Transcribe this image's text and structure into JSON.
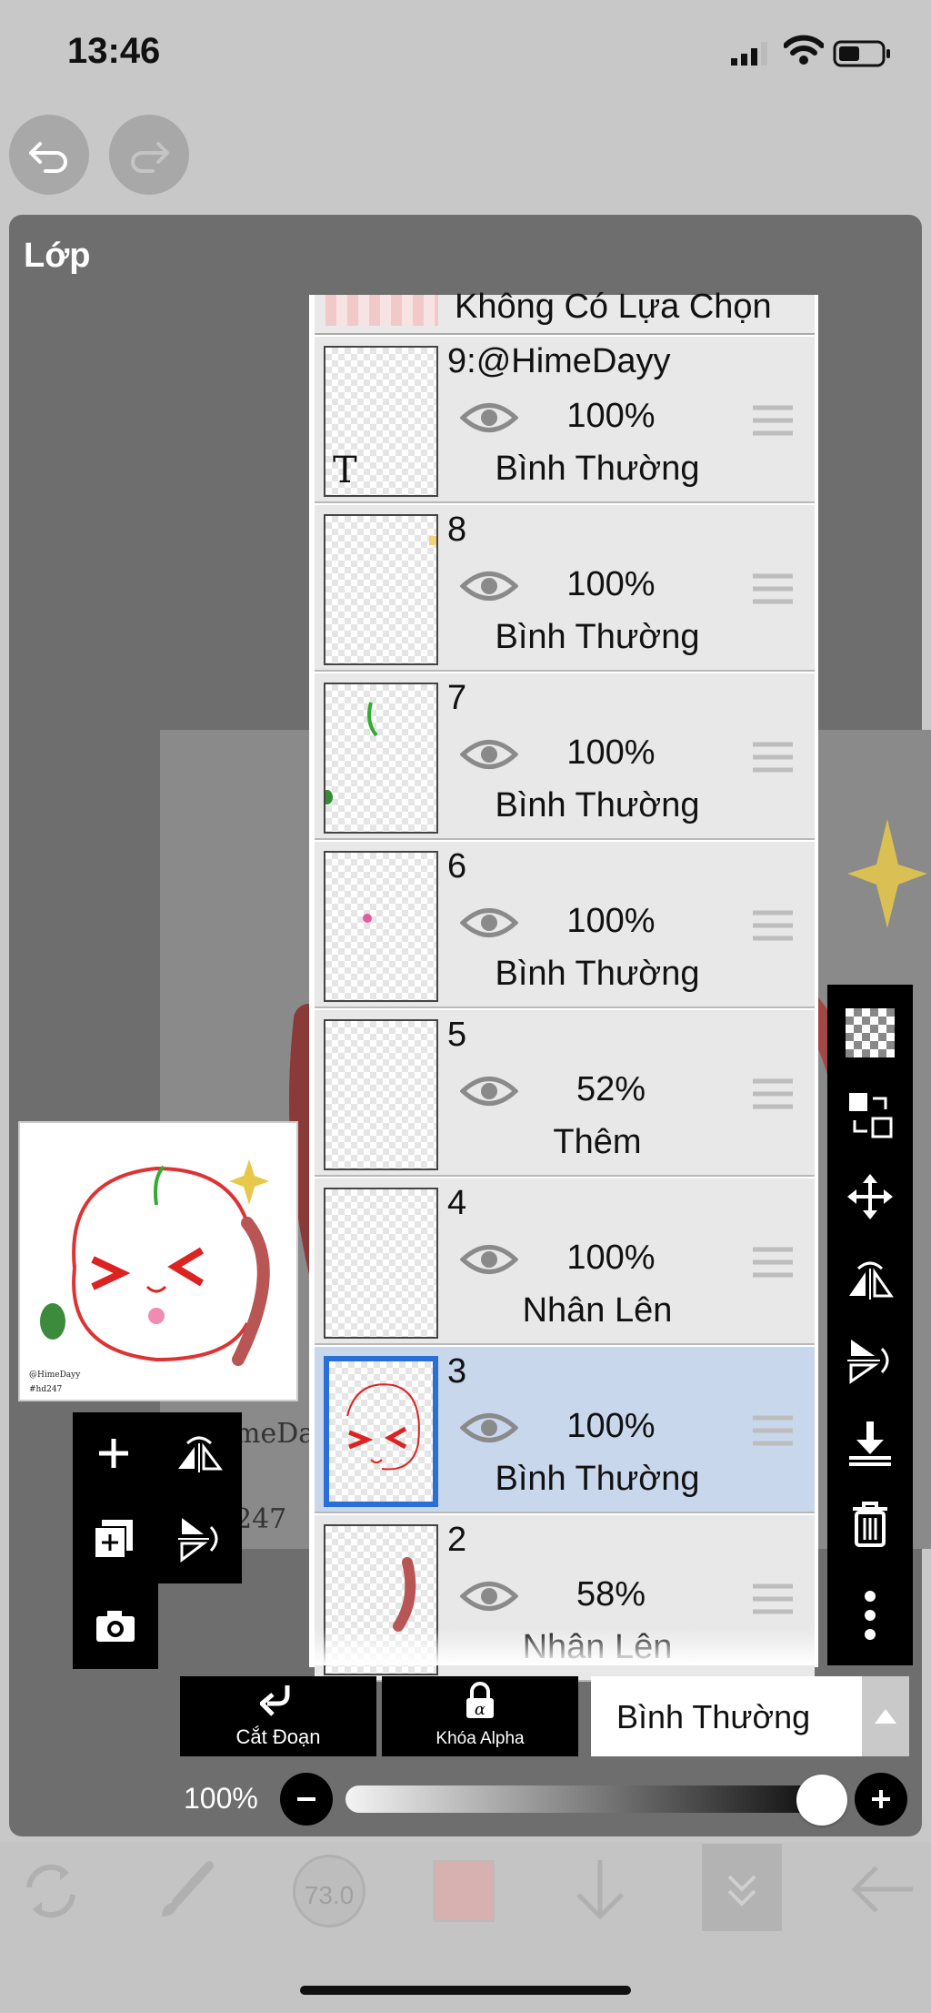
{
  "status_bar": {
    "time": "13:46"
  },
  "toolbar": {
    "undo_icon": "undo-icon",
    "redo_icon": "redo-icon"
  },
  "panel": {
    "title": "Lớp"
  },
  "canvas": {
    "text1": "meDa",
    "text2": "247"
  },
  "preview": {
    "text1": "@HimeDayy",
    "text2": "#hd247"
  },
  "layer_list": {
    "top_label": "Không Có Lựa Chọn",
    "layers": [
      {
        "name": "9:@HimeDayy",
        "opacity": "100%",
        "blend": "Bình Thường",
        "selected": false
      },
      {
        "name": "8",
        "opacity": "100%",
        "blend": "Bình Thường",
        "selected": false
      },
      {
        "name": "7",
        "opacity": "100%",
        "blend": "Bình Thường",
        "selected": false
      },
      {
        "name": "6",
        "opacity": "100%",
        "blend": "Bình Thường",
        "selected": false
      },
      {
        "name": "5",
        "opacity": "52%",
        "blend": "Thêm",
        "selected": false
      },
      {
        "name": "4",
        "opacity": "100%",
        "blend": "Nhân Lên",
        "selected": false
      },
      {
        "name": "3",
        "opacity": "100%",
        "blend": "Bình Thường",
        "selected": true
      },
      {
        "name": "2",
        "opacity": "58%",
        "blend": "Nhân Lên",
        "selected": false
      }
    ]
  },
  "bottom_controls": {
    "clip_label": "Cắt Đoạn",
    "alpha_lock_label": "Khóa Alpha",
    "blend_mode": "Bình Thường",
    "opacity_label": "100%",
    "opacity_value": 1.0
  },
  "bottom_bar": {
    "brush_size": "73.0"
  },
  "colors": {
    "accent": "#2a6fd6",
    "selected_row": "#c9d7ec",
    "panel": "#6e6e6e"
  }
}
